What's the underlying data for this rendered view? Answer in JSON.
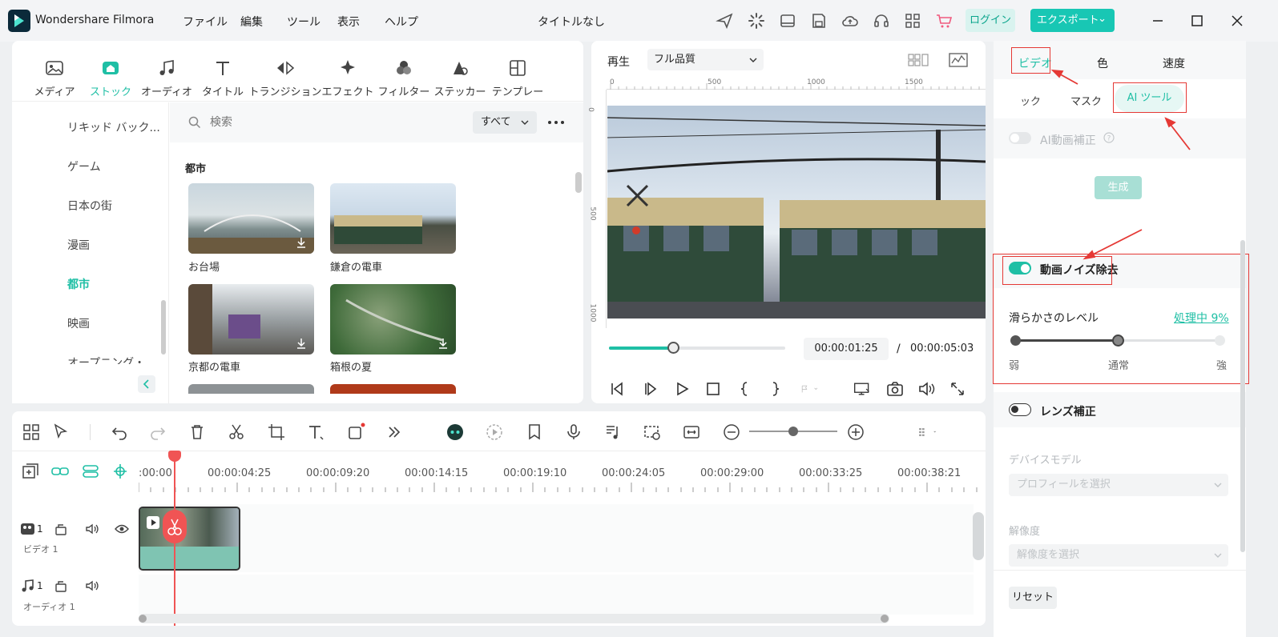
{
  "app": {
    "name": "Wondershare Filmora",
    "menu": [
      "ファイル",
      "編集",
      "ツール",
      "表示",
      "ヘルプ"
    ],
    "doc_title": "タイトルなし",
    "login_label": "ログイン",
    "export_label": "エクスポート",
    "export_chevron": "⌄"
  },
  "media_tabs": [
    {
      "label": "メディア",
      "icon": "media-icon"
    },
    {
      "label": "ストック",
      "icon": "stock-icon",
      "active": true
    },
    {
      "label": "オーディオ",
      "icon": "audio-icon"
    },
    {
      "label": "タイトル",
      "icon": "title-icon"
    },
    {
      "label": "トランジション",
      "icon": "transition-icon"
    },
    {
      "label": "エフェクト",
      "icon": "effect-icon"
    },
    {
      "label": "フィルター",
      "icon": "filter-icon"
    },
    {
      "label": "ステッカー",
      "icon": "sticker-icon"
    },
    {
      "label": "テンプレート",
      "icon": "template-icon"
    }
  ],
  "categories": [
    "リキッド バック...",
    "ゲーム",
    "日本の街",
    "漫画",
    "都市",
    "映画",
    "オープニング・"
  ],
  "active_category": "都市",
  "search": {
    "placeholder": "検索",
    "filter": "すべて"
  },
  "section_title": "都市",
  "stock_items": [
    {
      "label": "お台場"
    },
    {
      "label": "鎌倉の電車"
    },
    {
      "label": "京都の電車"
    },
    {
      "label": "箱根の夏"
    }
  ],
  "preview": {
    "play_label": "再生",
    "quality": "フル品質",
    "ruler_h": [
      "0",
      "500",
      "1000",
      "1500"
    ],
    "ruler_v": [
      "0",
      "500",
      "1000"
    ],
    "current_time": "00:00:01:25",
    "separator": "/",
    "total_time": "00:00:05:03",
    "progress": 0.37
  },
  "timeline": {
    "ruler": [
      ":00:00",
      "00:00:04:25",
      "00:00:09:20",
      "00:00:14:15",
      "00:00:19:10",
      "00:00:24:05",
      "00:00:29:00",
      "00:00:33:25",
      "00:00:38:21"
    ],
    "video_track_num": "1",
    "video_track_label": "ビデオ 1",
    "audio_track_num": "1",
    "audio_track_label": "オーディオ 1",
    "zoom": 0.5
  },
  "right_panel": {
    "tabs": [
      "ビデオ",
      "色",
      "速度"
    ],
    "subtabs": [
      "ック",
      "マスク",
      "AI ツール"
    ],
    "ai_video_fix": "AI動画補正",
    "generate": "生成",
    "denoise": "動画ノイズ除去",
    "smooth_level": "滑らかさのレベル",
    "processing": "処理中 9%",
    "level_labels": [
      "弱",
      "通常",
      "強"
    ],
    "level_value": 0.5,
    "lens_fix": "レンズ補正",
    "device_model": "デバイスモデル",
    "profile_placeholder": "プロフィールを選択",
    "resolution": "解像度",
    "resolution_placeholder": "解像度を選択",
    "reset": "リセット"
  },
  "colors": {
    "accent": "#1fbfa5",
    "red": "#e53935",
    "export_bg": "#18c7b4"
  }
}
